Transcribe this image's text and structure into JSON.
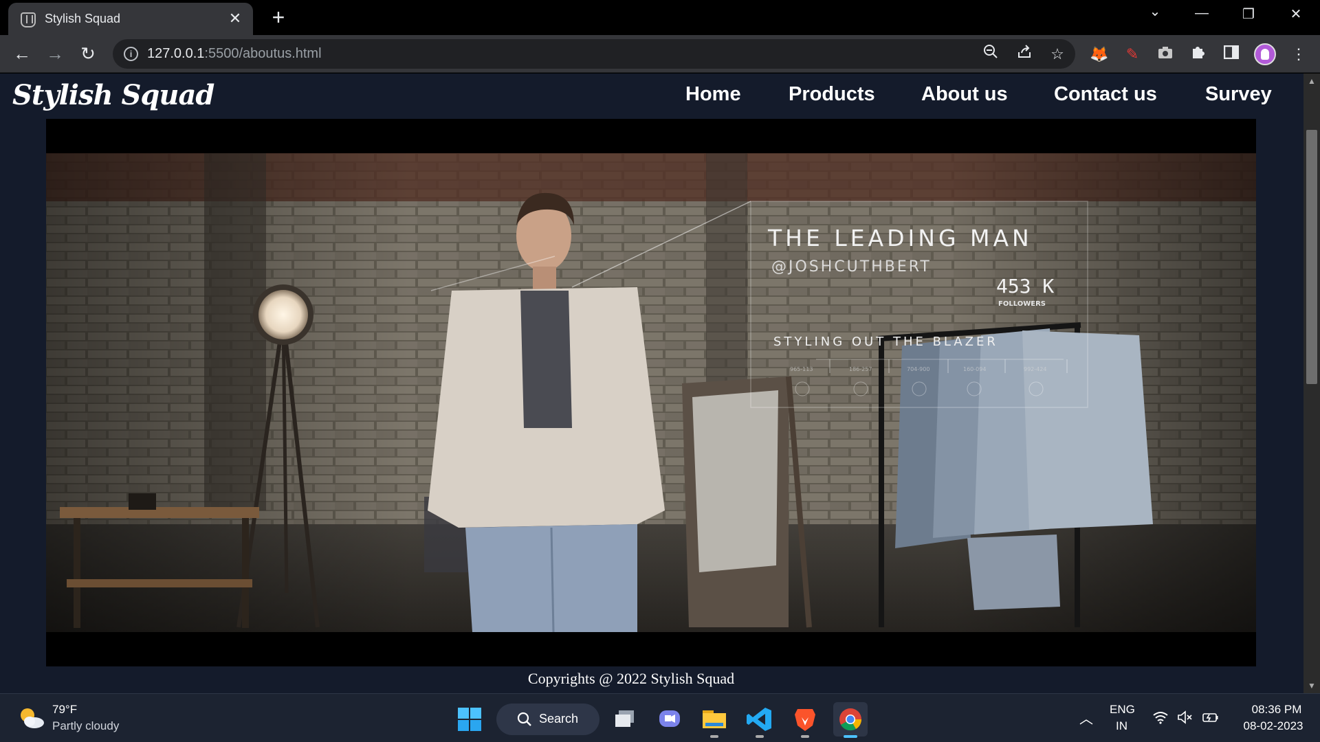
{
  "browser": {
    "tab_title": "Stylish Squad",
    "url_host": "127.0.0.1",
    "url_rest": ":5500/aboutus.html"
  },
  "site": {
    "logo": "Stylish Squad",
    "nav": [
      "Home",
      "Products",
      "About us",
      "Contact us",
      "Survey"
    ],
    "footer": "Copyrights @ 2022 Stylish Squad"
  },
  "video_overlay": {
    "title": "THE LEADING MAN",
    "handle": "@JOSHCUTHBERT",
    "followers_count": "453 K",
    "followers_label": "FOLLOWERS",
    "caption": "STYLING OUT THE BLAZER",
    "codes": [
      "965-113",
      "186-257",
      "704-900",
      "160-094",
      "992-424"
    ]
  },
  "taskbar": {
    "temperature": "79°F",
    "weather": "Partly cloudy",
    "search_label": "Search",
    "lang_1": "ENG",
    "lang_2": "IN",
    "time": "08:36 PM",
    "date": "08-02-2023"
  },
  "icons": {
    "back": "arrow-left-icon",
    "forward": "arrow-right-icon",
    "reload": "reload-icon",
    "zoom": "magnifier-icon",
    "share": "share-icon",
    "bookmark": "star-icon"
  },
  "colors": {
    "page_bg": "#141b2b",
    "browser_bg": "#35363a",
    "taskbar_bg": "#1c2331"
  }
}
